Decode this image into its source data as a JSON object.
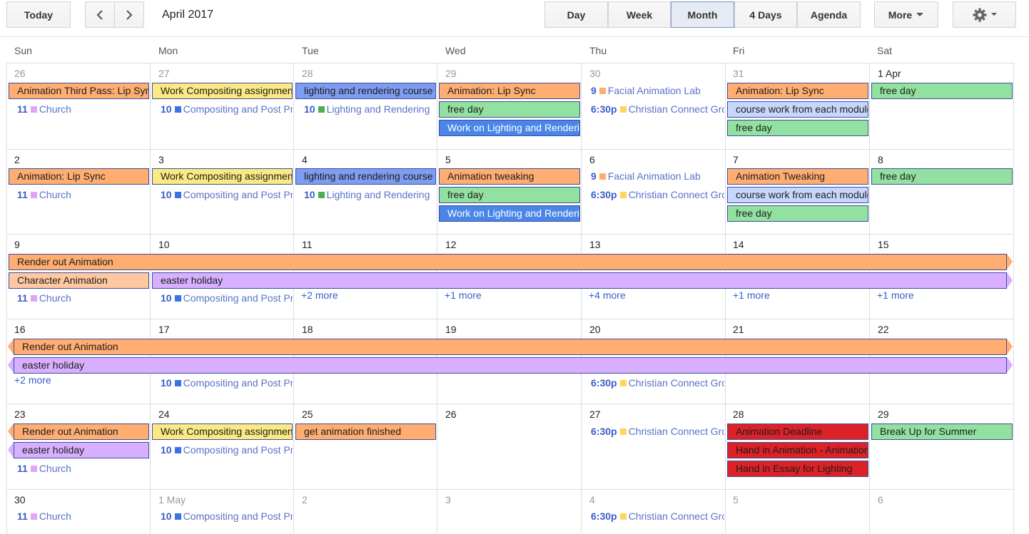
{
  "toolbar": {
    "today": "Today",
    "prev_icon": "chevron-left-icon",
    "next_icon": "chevron-right-icon",
    "month_title": "April 2017",
    "views": [
      "Day",
      "Week",
      "Month",
      "4 Days",
      "Agenda"
    ],
    "selected_view": "Month",
    "more": "More",
    "settings_icon": "gear-icon"
  },
  "weekdays": [
    "Sun",
    "Mon",
    "Tue",
    "Wed",
    "Thu",
    "Fri",
    "Sat"
  ],
  "colors": {
    "orange": "#ffad70",
    "yellow": "#fbe983",
    "blue": "#7e9cf0",
    "darkblue": "#4a86e8",
    "green": "#92e1a0",
    "lightblue": "#c7d6fb",
    "purple": "#d8b0ff",
    "peach": "#ffc8a0",
    "red": "#dc2127",
    "church": "#dda6f7",
    "comp": "#3a73e6",
    "light": "#4caf50",
    "facial": "#ffad70",
    "cc": "#fbd75b"
  },
  "weeks": [
    {
      "days": [
        "26",
        "27",
        "28",
        "29",
        "30",
        "31",
        "1 Apr"
      ]
    },
    {
      "days": [
        "2",
        "3",
        "4",
        "5",
        "6",
        "7",
        "8"
      ]
    },
    {
      "days": [
        "9",
        "10",
        "11",
        "12",
        "13",
        "14",
        "15"
      ]
    },
    {
      "days": [
        "16",
        "17",
        "18",
        "19",
        "20",
        "21",
        "22"
      ]
    },
    {
      "days": [
        "23",
        "24",
        "25",
        "26",
        "27",
        "28",
        "29"
      ]
    },
    {
      "days": [
        "30",
        "1 May",
        "2",
        "3",
        "4",
        "5",
        "6"
      ]
    }
  ],
  "events": {
    "w0": {
      "sun_bar": "Animation Third Pass: Lip Sync",
      "mon_bar": "Work Compositing assignment",
      "tue_bar": "lighting and rendering course",
      "wed_bar1": "Animation: Lip Sync",
      "wed_bar2": "free day",
      "wed_bar3": "Work on Lighting and Rendering",
      "fri_bar1": "Animation: Lip Sync",
      "fri_bar2": "course work from each module",
      "fri_bar3": "free day",
      "sat_bar": "free day",
      "sun_t": {
        "time": "11",
        "name": "Church"
      },
      "mon_t": {
        "time": "10",
        "name": "Compositing and Post Production"
      },
      "tue_t": {
        "time": "10",
        "name": "Lighting and Rendering"
      },
      "thu_t1": {
        "time": "9",
        "name": "Facial Animation Lab"
      },
      "thu_t2": {
        "time": "6:30p",
        "name": "Christian Connect Group"
      }
    },
    "w1": {
      "sun_bar": "Animation: Lip Sync",
      "mon_bar": "Work Compositing assignment",
      "tue_bar": "lighting and rendering course",
      "wed_bar1": "Animation tweaking",
      "wed_bar2": "free day",
      "wed_bar3": "Work on Lighting and Rendering",
      "fri_bar1": "Animation Tweaking",
      "fri_bar2": "course work from each module",
      "fri_bar3": "free day",
      "sat_bar": "free day",
      "sun_t": {
        "time": "11",
        "name": "Church"
      },
      "mon_t": {
        "time": "10",
        "name": "Compositing and Post Production"
      },
      "tue_t": {
        "time": "10",
        "name": "Lighting and Rendering"
      },
      "thu_t1": {
        "time": "9",
        "name": "Facial Animation Lab"
      },
      "thu_t2": {
        "time": "6:30p",
        "name": "Christian Connect Group"
      }
    },
    "w2": {
      "span1": "Render out Animation",
      "sun_bar": "Character Animation",
      "span2": "easter holiday",
      "sun_t": {
        "time": "11",
        "name": "Church"
      },
      "mon_t": {
        "time": "10",
        "name": "Compositing and Post Production"
      },
      "more_tue": "+2 more",
      "more_wed": "+1 more",
      "more_thu": "+4 more",
      "more_fri": "+1 more",
      "more_sat": "+1 more"
    },
    "w3": {
      "span1": "Render out Animation",
      "span2": "easter holiday",
      "more_sun": "+2 more",
      "mon_t": {
        "time": "10",
        "name": "Compositing and Post Production"
      },
      "thu_t": {
        "time": "6:30p",
        "name": "Christian Connect Group"
      }
    },
    "w4": {
      "sun_bar1": "Render out Animation",
      "sun_bar2": "easter holiday",
      "mon_bar": "Work Compositing assignment",
      "tue_bar": "get animation finished",
      "fri_bar1": "Animation Deadline",
      "fri_bar2": "Hand in Animation - Animation",
      "fri_bar3": "Hand in Essay for Lighting",
      "sat_bar": "Break Up for Summer",
      "sun_t": {
        "time": "11",
        "name": "Church"
      },
      "mon_t": {
        "time": "10",
        "name": "Compositing and Post Production"
      },
      "thu_t": {
        "time": "6:30p",
        "name": "Christian Connect Group"
      }
    },
    "w5": {
      "sun_t": {
        "time": "11",
        "name": "Church"
      },
      "mon_t": {
        "time": "10",
        "name": "Compositing and Post Production"
      },
      "thu_t": {
        "time": "6:30p",
        "name": "Christian Connect Group"
      }
    }
  }
}
